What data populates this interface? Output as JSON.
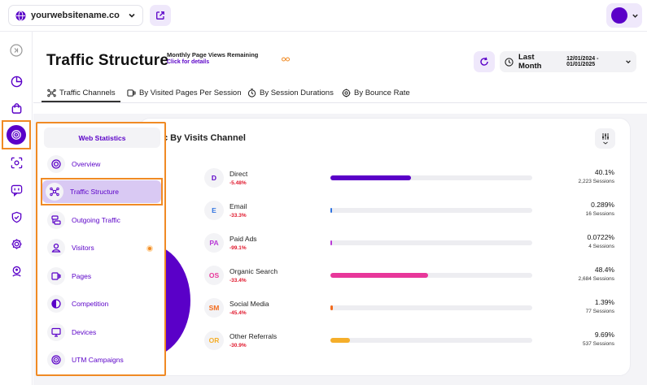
{
  "topbar": {
    "site_name": "yourwebsitename.co",
    "icons": [
      "globe-icon",
      "chevron-down-icon",
      "external-link-icon",
      "avatar"
    ]
  },
  "rail": {
    "icons": [
      "collapse-icon",
      "chart-pie-icon",
      "shopping-bag-icon",
      "traffic-icon",
      "scan-icon",
      "chat-icon",
      "shield-icon",
      "gear-icon",
      "user-pin-icon"
    ]
  },
  "header": {
    "title": "Traffic Structure",
    "page_views_title": "Monthly Page Views Remaining",
    "page_views_link": "Click for details",
    "date_label": "Last Month",
    "date_range": "12/01/2024 - 01/01/2025"
  },
  "tabs": [
    {
      "label": "Traffic Channels",
      "icon": "network-icon"
    },
    {
      "label": "By Visited Pages Per Session",
      "icon": "pages-icon"
    },
    {
      "label": "By Session Durations",
      "icon": "timer-icon"
    },
    {
      "label": "By Bounce Rate",
      "icon": "bounce-icon"
    }
  ],
  "card": {
    "title_visible": "c By Visits Channel"
  },
  "channels": [
    {
      "badge": "D",
      "name": "Direct",
      "change": "-5.48%",
      "pct": "40.1%",
      "sessions": "2,223 Sessions",
      "value": 0.401,
      "color": "#5a00c8",
      "badge_color": "#5a00c8"
    },
    {
      "badge": "E",
      "name": "Email",
      "change": "-33.3%",
      "pct": "0.289%",
      "sessions": "16 Sessions",
      "value": 0.00289,
      "color": "#2f73e0",
      "badge_color": "#2f73e0"
    },
    {
      "badge": "PA",
      "name": "Paid Ads",
      "change": "-99.1%",
      "pct": "0.0722%",
      "sessions": "4 Sessions",
      "value": 0.000722,
      "color": "#b93ad6",
      "badge_color": "#b93ad6"
    },
    {
      "badge": "OS",
      "name": "Organic Search",
      "change": "-33.4%",
      "pct": "48.4%",
      "sessions": "2,684 Sessions",
      "value": 0.484,
      "color": "#e8379a",
      "badge_color": "#e8379a"
    },
    {
      "badge": "SM",
      "name": "Social Media",
      "change": "-45.4%",
      "pct": "1.39%",
      "sessions": "77 Sessions",
      "value": 0.0139,
      "color": "#f26b1d",
      "badge_color": "#f26b1d"
    },
    {
      "badge": "OR",
      "name": "Other Referrals",
      "change": "-30.9%",
      "pct": "9.69%",
      "sessions": "537 Sessions",
      "value": 0.0969,
      "color": "#f5ae2a",
      "badge_color": "#f5ae2a"
    }
  ],
  "nav": {
    "header": "Web Statistics",
    "items": [
      {
        "label": "Overview",
        "icon": "target-icon"
      },
      {
        "label": "Traffic Structure",
        "icon": "network-icon",
        "active": true
      },
      {
        "label": "Outgoing Traffic",
        "icon": "outgoing-icon"
      },
      {
        "label": "Visitors",
        "icon": "user-icon",
        "dot": true
      },
      {
        "label": "Pages",
        "icon": "pages-icon"
      },
      {
        "label": "Competition",
        "icon": "half-circle-icon"
      },
      {
        "label": "Devices",
        "icon": "monitor-icon"
      },
      {
        "label": "UTM Campaigns",
        "icon": "campaign-icon"
      }
    ]
  },
  "colors": {
    "brand": "#5a00c8",
    "highlight": "#f08a24",
    "negative": "#e0162b"
  }
}
